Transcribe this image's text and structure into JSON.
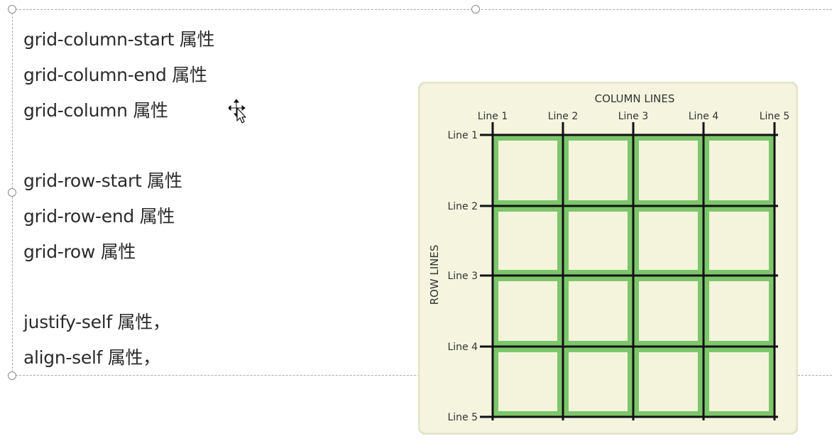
{
  "text_lines": [
    "grid-column-start 属性",
    "grid-column-end 属性",
    "grid-column 属性",
    "grid-row-start 属性",
    "grid-row-end 属性",
    "grid-row 属性",
    "justify-self 属性，",
    "align-self 属性，"
  ],
  "diagram": {
    "column_title": "COLUMN LINES",
    "row_title": "ROW LINES",
    "column_lines": [
      "Line 1",
      "Line 2",
      "Line 3",
      "Line 4",
      "Line 5"
    ],
    "row_lines": [
      "Line 1",
      "Line 2",
      "Line 3",
      "Line 4",
      "Line 5"
    ],
    "colors": {
      "panel": "#f4f4df",
      "panel_border": "#e3e3c8",
      "cell": "#f4f4dc",
      "track": "#7cc66b",
      "line": "#111111"
    }
  },
  "icons": {
    "cursor": "move-cursor-icon"
  }
}
